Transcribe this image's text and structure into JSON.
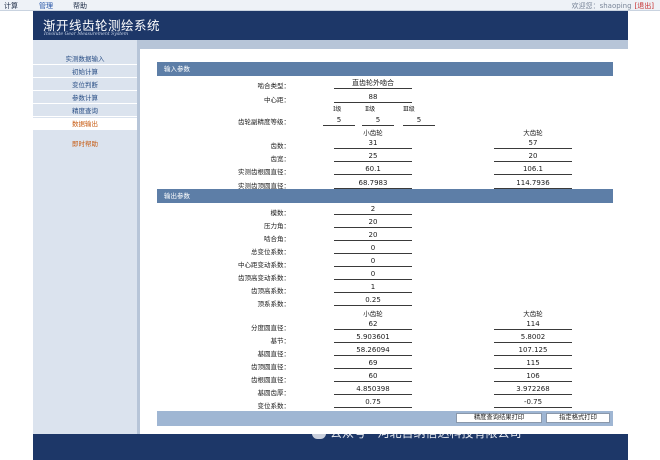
{
  "topbar": {
    "menu": [
      "计算",
      "管理",
      "帮助"
    ],
    "welcome": "欢迎您：shaoping",
    "logout": "[退出]"
  },
  "banner": {
    "title": "渐开线齿轮测绘系统",
    "subtitle": "Involute Gear Measurement System"
  },
  "sidebar": {
    "items": [
      "实测数据输入",
      "初始计算",
      "变位判断",
      "参数计算",
      "精度查询",
      "数据输出"
    ],
    "active_index": 5,
    "help": "即时帮助"
  },
  "input_section": {
    "title": "输入参数",
    "mesh_type_label": "啮合类型：",
    "mesh_type": "直齿轮外啮合",
    "center_distance_label": "中心距：",
    "center_distance": "88",
    "grades": [
      "Ⅰ级",
      "Ⅱ级",
      "Ⅲ级"
    ],
    "precision_label": "齿轮副精度等级：",
    "precision": [
      "5",
      "5",
      "5"
    ],
    "small_gear": "小齿轮",
    "large_gear": "大齿轮",
    "rows": [
      {
        "label": "齿数：",
        "small": "31",
        "large": "57"
      },
      {
        "label": "齿宽：",
        "small": "25",
        "large": "20"
      },
      {
        "label": "实测齿根圆直径：",
        "small": "60.1",
        "large": "106.1"
      },
      {
        "label": "实测齿顶圆直径：",
        "small": "68.7983",
        "large": "114.7936"
      }
    ]
  },
  "output_section": {
    "title": "输出参数",
    "single_rows": [
      {
        "label": "模数：",
        "value": "2"
      },
      {
        "label": "压力角：",
        "value": "20"
      },
      {
        "label": "啮合角：",
        "value": "20"
      },
      {
        "label": "总变位系数：",
        "value": "0"
      },
      {
        "label": "中心距变动系数：",
        "value": "0"
      },
      {
        "label": "齿顶高变动系数：",
        "value": "0"
      },
      {
        "label": "齿顶高系数：",
        "value": "1"
      },
      {
        "label": "顶系系数：",
        "value": "0.25"
      }
    ],
    "small_gear": "小齿轮",
    "large_gear": "大齿轮",
    "pair_rows": [
      {
        "label": "分度圆直径：",
        "small": "62",
        "large": "114"
      },
      {
        "label": "基节：",
        "small": "5.903601",
        "large": "5.8002"
      },
      {
        "label": "基圆直径：",
        "small": "58.26094",
        "large": "107.125"
      },
      {
        "label": "齿顶圆直径：",
        "small": "69",
        "large": "115"
      },
      {
        "label": "齿根圆直径：",
        "small": "60",
        "large": "106"
      },
      {
        "label": "基圆齿厚：",
        "small": "4.850398",
        "large": "3.972268"
      },
      {
        "label": "变位系数：",
        "small": "0.75",
        "large": "-0.75"
      }
    ]
  },
  "buttons": {
    "print_precision": "精度查询结果打印",
    "print_custom": "指定格式打印"
  },
  "watermark": "公众号 · 河北百纳信达科技有限公司",
  "colors": {
    "banner": "#1d3768",
    "section_header": "#5d7ea7",
    "sidebar": "#dbe3ee",
    "sidebar_active_text": "#c75b12",
    "frame": "#b7c5d8"
  }
}
